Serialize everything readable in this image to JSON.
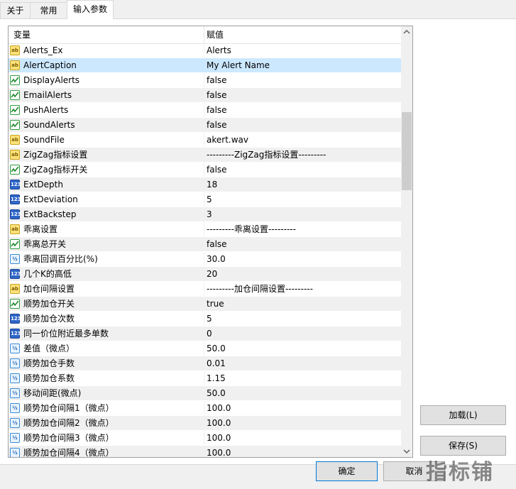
{
  "tabs": [
    {
      "label": "关于"
    },
    {
      "label": "常用"
    },
    {
      "label": "输入参数"
    }
  ],
  "grid": {
    "header": {
      "variable": "变量",
      "value": "赋值"
    },
    "rows": [
      {
        "type": "ab",
        "icon": "ab",
        "name": "Alerts_Ex",
        "value": "Alerts"
      },
      {
        "type": "ab",
        "icon": "ab",
        "name": "AlertCaption",
        "value": "My Alert Name"
      },
      {
        "type": "bool",
        "icon": "",
        "name": "DisplayAlerts",
        "value": "false"
      },
      {
        "type": "bool",
        "icon": "",
        "name": "EmailAlerts",
        "value": "false"
      },
      {
        "type": "bool",
        "icon": "",
        "name": "PushAlerts",
        "value": "false"
      },
      {
        "type": "bool",
        "icon": "",
        "name": "SoundAlerts",
        "value": "false"
      },
      {
        "type": "ab",
        "icon": "ab",
        "name": "SoundFile",
        "value": "akert.wav"
      },
      {
        "type": "ab",
        "icon": "ab",
        "name": "ZigZag指标设置",
        "value": "---------ZigZag指标设置---------"
      },
      {
        "type": "bool",
        "icon": "",
        "name": "ZigZag指标开关",
        "value": "false"
      },
      {
        "type": "int",
        "icon": "123",
        "name": "ExtDepth",
        "value": "18"
      },
      {
        "type": "int",
        "icon": "123",
        "name": "ExtDeviation",
        "value": "5"
      },
      {
        "type": "int",
        "icon": "123",
        "name": "ExtBackstep",
        "value": "3"
      },
      {
        "type": "ab",
        "icon": "ab",
        "name": "乖离设置",
        "value": "---------乖离设置---------"
      },
      {
        "type": "bool",
        "icon": "",
        "name": "乖离总开关",
        "value": "false"
      },
      {
        "type": "dbl",
        "icon": "½",
        "name": "乖离回调百分比(%)",
        "value": "30.0"
      },
      {
        "type": "int",
        "icon": "123",
        "name": "几个K的高低",
        "value": "20"
      },
      {
        "type": "ab",
        "icon": "ab",
        "name": "加仓间隔设置",
        "value": "---------加仓间隔设置---------"
      },
      {
        "type": "bool",
        "icon": "",
        "name": "顺势加仓开关",
        "value": "true"
      },
      {
        "type": "int",
        "icon": "123",
        "name": "顺势加仓次数",
        "value": "5"
      },
      {
        "type": "int",
        "icon": "123",
        "name": "同一价位附近最多单数",
        "value": "0"
      },
      {
        "type": "dbl",
        "icon": "½",
        "name": "差值（微点）",
        "value": "50.0"
      },
      {
        "type": "dbl",
        "icon": "½",
        "name": "顺势加仓手数",
        "value": "0.01"
      },
      {
        "type": "dbl",
        "icon": "½",
        "name": "顺势加仓系数",
        "value": "1.15"
      },
      {
        "type": "dbl",
        "icon": "½",
        "name": "移动间距(微点)",
        "value": "50.0"
      },
      {
        "type": "dbl",
        "icon": "½",
        "name": "顺势加仓间隔1（微点）",
        "value": "100.0"
      },
      {
        "type": "dbl",
        "icon": "½",
        "name": "顺势加仓间隔2（微点）",
        "value": "100.0"
      },
      {
        "type": "dbl",
        "icon": "½",
        "name": "顺势加仓间隔3（微点）",
        "value": "100.0"
      },
      {
        "type": "dbl",
        "icon": "½",
        "name": "顺势加仓间隔4（微点）",
        "value": "100.0"
      }
    ]
  },
  "buttons": {
    "load": "加载(L)",
    "save": "保存(S)",
    "ok": "确定",
    "cancel": "取消"
  },
  "watermark": "指标铺",
  "icons": {
    "scroll_up": "scroll-up-arrow-icon",
    "scroll_down": "scroll-down-arrow-icon"
  },
  "colors": {
    "selected_row": "#cce8ff",
    "alt_row": "#f0f0f0",
    "default_button_border": "#0078d7"
  }
}
